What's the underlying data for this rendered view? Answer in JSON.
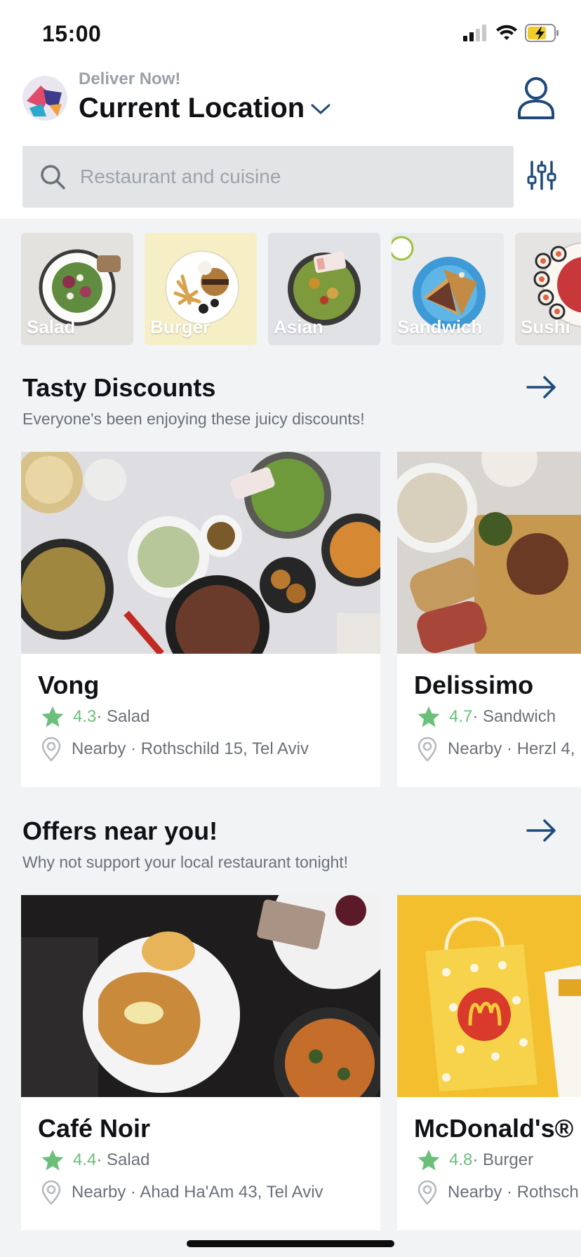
{
  "status_bar": {
    "time": "15:00"
  },
  "header": {
    "deliver_label": "Deliver Now!",
    "location_label": "Current Location"
  },
  "search": {
    "placeholder": "Restaurant and cuisine"
  },
  "categories": [
    {
      "label": "Salad"
    },
    {
      "label": "Burger"
    },
    {
      "label": "Asian"
    },
    {
      "label": "Sandwich"
    },
    {
      "label": "Sushi"
    }
  ],
  "sections": [
    {
      "title": "Tasty Discounts",
      "subtitle": "Everyone's been enjoying these juicy discounts!",
      "cards": [
        {
          "name": "Vong",
          "rating": "4.3",
          "cuisine": "· Salad",
          "location": "Nearby · Rothschild 15, Tel Aviv"
        },
        {
          "name": "Delissimo",
          "rating": "4.7",
          "cuisine": "· Sandwich",
          "location": "Nearby · Herzl 4,"
        }
      ]
    },
    {
      "title": "Offers near you!",
      "subtitle": "Why not support your local restaurant tonight!",
      "cards": [
        {
          "name": "Café Noir",
          "rating": "4.4",
          "cuisine": "· Salad",
          "location": "Nearby · Ahad Ha'Am 43, Tel Aviv"
        },
        {
          "name": "McDonald's®",
          "rating": "4.8",
          "cuisine": "· Burger",
          "location": "Nearby · Rothsch"
        }
      ]
    }
  ],
  "colors": {
    "accent": "#1d4a7a",
    "rating_green": "#6cbf7a",
    "search_bg": "#e3e4e6",
    "page_bg": "#f2f3f5"
  },
  "icons": [
    "signal-icon",
    "wifi-icon",
    "battery-icon",
    "profile-icon",
    "chevron-down-icon",
    "search-icon",
    "filter-icon",
    "arrow-right-icon",
    "star-icon",
    "location-pin-icon"
  ]
}
